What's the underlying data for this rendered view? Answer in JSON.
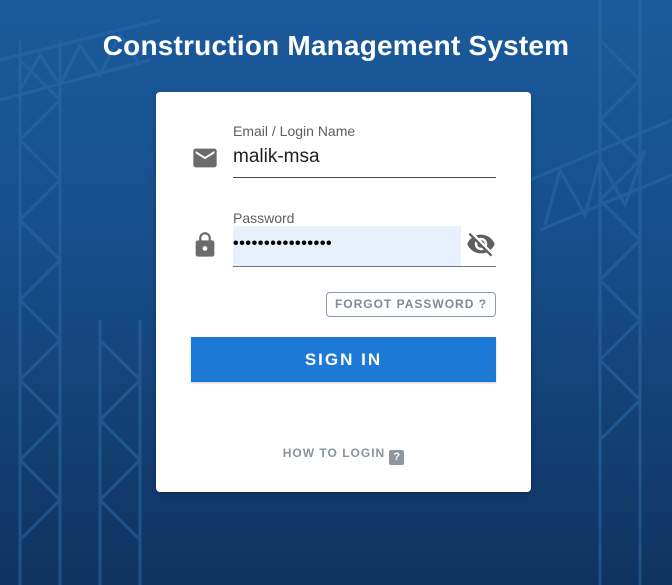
{
  "header": {
    "title": "Construction Management System"
  },
  "login_form": {
    "email": {
      "label": "Email / Login Name",
      "value": "malik-msa",
      "icon": "email-icon"
    },
    "password": {
      "label": "Password",
      "masked_value": "••••••••••••••••",
      "icon": "lock-icon",
      "toggle_icon": "eye-off-icon"
    },
    "forgot_label": "FORGOT PASSWORD ?",
    "signin_label": "SIGN IN",
    "howto_label": "HOW TO LOGIN",
    "howto_icon_text": "?"
  },
  "colors": {
    "background": "#174f8c",
    "card": "#ffffff",
    "primary": "#1e78d6",
    "autofill": "#e8f0fe",
    "muted": "#8b939c"
  }
}
